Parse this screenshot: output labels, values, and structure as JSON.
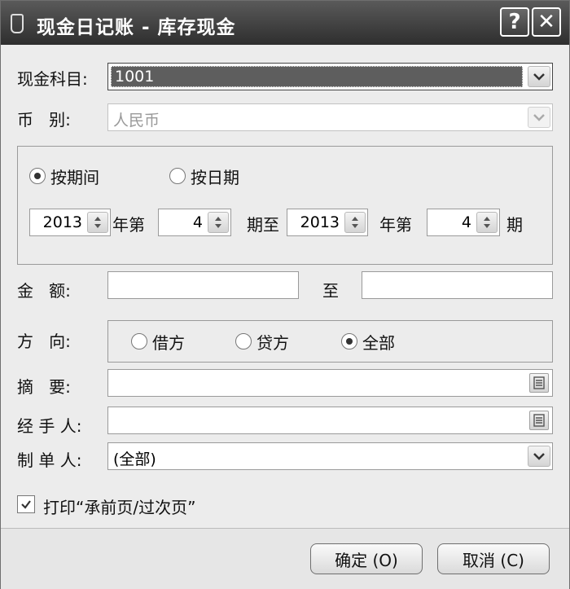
{
  "window": {
    "title": "现金日记账 - 库存现金",
    "help_label": "?",
    "close_label": "✕",
    "icon": "app-icon"
  },
  "account": {
    "label": "现金科目:",
    "value": "1001"
  },
  "currency": {
    "label": "币   别:",
    "value": "人民币"
  },
  "period": {
    "by_period_label": "按期间",
    "by_date_label": "按日期",
    "selected": "by_period",
    "from_year": "2013",
    "year_label_1": "年第",
    "from_period": "4",
    "period_to_label": "期至",
    "to_year": "2013",
    "year_label_2": "年第",
    "to_period": "4",
    "period_label": "期"
  },
  "amount": {
    "label": "金   额:",
    "to_label": "至",
    "from_value": "",
    "to_value": ""
  },
  "direction": {
    "label": "方   向:",
    "debit_label": "借方",
    "credit_label": "贷方",
    "all_label": "全部",
    "selected": "all"
  },
  "summary": {
    "label": "摘   要:",
    "value": ""
  },
  "handler": {
    "label": "经 手 人:",
    "value": ""
  },
  "maker": {
    "label": "制 单 人:",
    "value": "(全部)"
  },
  "print_option": {
    "label": "打印“承前页/过次页”",
    "checked": true
  },
  "buttons": {
    "ok_label": "确定 (O)",
    "cancel_label": "取消 (C)"
  }
}
